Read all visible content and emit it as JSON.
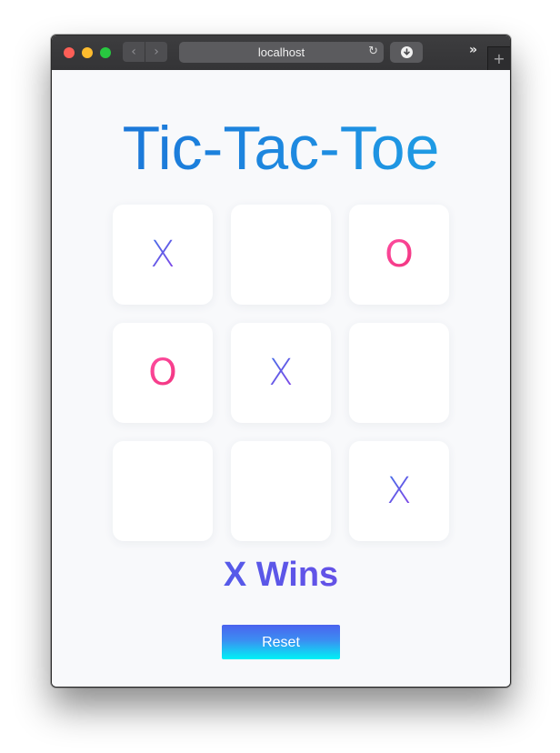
{
  "browser": {
    "url": "localhost",
    "back_glyph": "‹",
    "forward_glyph": "›",
    "reload_glyph": "↻",
    "more_glyph": "»",
    "new_tab_glyph": "+"
  },
  "page": {
    "title": "Tic-Tac-Toe",
    "board": [
      "X",
      "",
      "O",
      "O",
      "X",
      "",
      "",
      "",
      "X"
    ],
    "status": "X Wins",
    "reset_label": "Reset"
  },
  "colors": {
    "x_mark": "#5a5ce8",
    "o_mark": "#f2408f",
    "title": "#1a7ad9",
    "button_top": "#4b63ee",
    "button_bottom": "#00f2f5"
  }
}
